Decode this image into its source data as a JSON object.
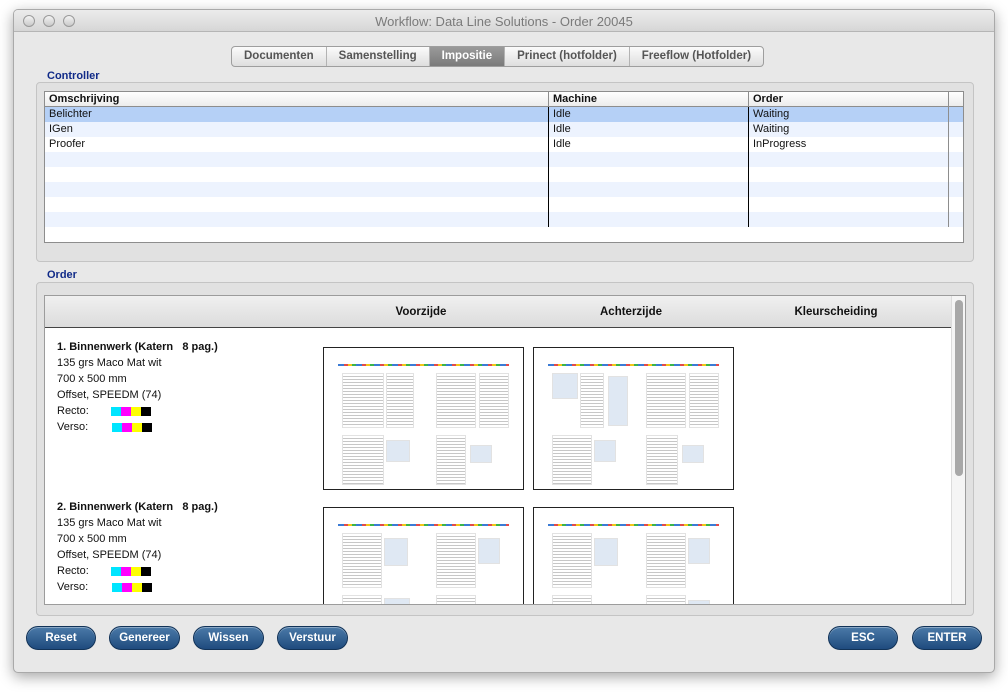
{
  "window": {
    "title": "Workflow: Data Line Solutions - Order 20045"
  },
  "tabs": [
    {
      "label": "Documenten",
      "active": false
    },
    {
      "label": "Samenstelling",
      "active": false
    },
    {
      "label": "Impositie",
      "active": true
    },
    {
      "label": "Prinect (hotfolder)",
      "active": false
    },
    {
      "label": "Freeflow (Hotfolder)",
      "active": false
    }
  ],
  "controller": {
    "label": "Controller",
    "columns": [
      "Omschrijving",
      "Machine",
      "Order"
    ],
    "rows": [
      {
        "omschrijving": "Belichter",
        "machine": "Idle",
        "order": "Waiting",
        "selected": true
      },
      {
        "omschrijving": "IGen",
        "machine": "Idle",
        "order": "Waiting",
        "selected": false
      },
      {
        "omschrijving": "Proofer",
        "machine": "Idle",
        "order": "InProgress",
        "selected": false
      }
    ]
  },
  "order": {
    "label": "Order",
    "columns": {
      "front": "Voorzijde",
      "back": "Achterzijde",
      "separation": "Kleurscheiding"
    },
    "jobs": [
      {
        "title": "1. Binnenwerk (Katern",
        "pages": "8 pag.)",
        "paper": "135 grs Maco Mat wit",
        "size": "700 x 500 mm",
        "press": "Offset, SPEEDM (74)",
        "recto_label": "Recto:",
        "verso_label": "Verso:"
      },
      {
        "title": "2. Binnenwerk (Katern",
        "pages": "8 pag.)",
        "paper": "135 grs Maco Mat wit",
        "size": "700 x 500 mm",
        "press": "Offset, SPEEDM (74)",
        "recto_label": "Recto:",
        "verso_label": "Verso:"
      }
    ],
    "ink_colors": [
      "#00e5ff",
      "#ff00ff",
      "#ffff00",
      "#000000"
    ]
  },
  "buttons": {
    "reset": "Reset",
    "genereer": "Genereer",
    "wissen": "Wissen",
    "verstuur": "Verstuur",
    "esc": "ESC",
    "enter": "ENTER"
  }
}
